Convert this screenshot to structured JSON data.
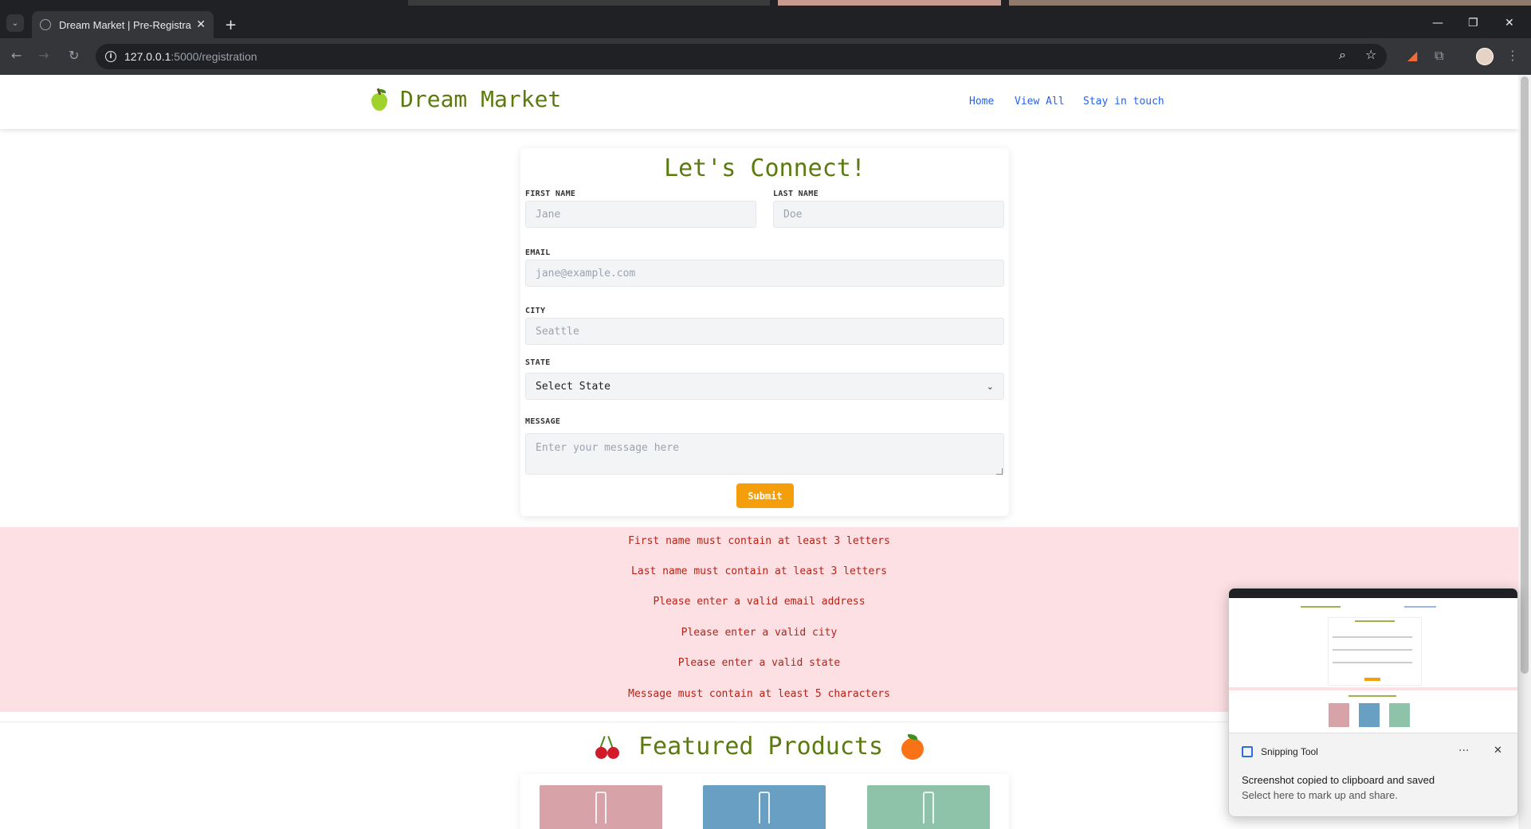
{
  "browser": {
    "tab_title": "Dream Market | Pre-Registration",
    "tab_close": "✕",
    "new_tab": "+",
    "url_host": "127.0.0.1",
    "url_path": ":5000/registration",
    "window_controls": {
      "minimize": "—",
      "maximize": "❐",
      "close": "✕"
    }
  },
  "site": {
    "brand": "Dream Market",
    "nav": [
      "Home",
      "View All",
      "Stay in touch"
    ]
  },
  "form": {
    "title": "Let's Connect!",
    "first_name": {
      "label": "FIRST NAME",
      "placeholder": "Jane",
      "value": ""
    },
    "last_name": {
      "label": "LAST NAME",
      "placeholder": "Doe",
      "value": ""
    },
    "email": {
      "label": "EMAIL",
      "placeholder": "jane@example.com",
      "value": ""
    },
    "city": {
      "label": "CITY",
      "placeholder": "Seattle",
      "value": ""
    },
    "state": {
      "label": "STATE",
      "selected": "Select State"
    },
    "message": {
      "label": "MESSAGE",
      "placeholder": "Enter your message here",
      "value": ""
    },
    "submit": "Submit"
  },
  "errors": [
    "First name must contain at least 3 letters",
    "Last name must contain at least 3 letters",
    "Please enter a valid email address",
    "Please enter a valid city",
    "Please enter a valid state",
    "Message must contain at least 5 characters"
  ],
  "featured": {
    "title": "Featured Products",
    "product_colors": [
      "#d7a3a8",
      "#6a9fc4",
      "#8fc3a9"
    ]
  },
  "snipping_tool": {
    "app_name": "Snipping Tool",
    "message": "Screenshot copied to clipboard and saved",
    "sub": "Select here to mark up and share.",
    "more": "···",
    "close": "✕"
  },
  "colors": {
    "brand_green": "#5b7a0f",
    "accent_orange": "#f59e0b",
    "error_bg": "#fde0e3",
    "error_text": "#b42318",
    "link_blue": "#2563eb"
  },
  "icons": [
    "dropdown-icon",
    "tab-favicon-icon",
    "close-icon",
    "plus-icon",
    "back-icon",
    "forward-icon",
    "reload-icon",
    "info-icon",
    "zoom-icon",
    "star-icon",
    "extension-icon",
    "menu-icon",
    "pear-icon",
    "cherry-icon",
    "peach-icon",
    "chevron-down-icon",
    "snipping-tool-icon"
  ]
}
